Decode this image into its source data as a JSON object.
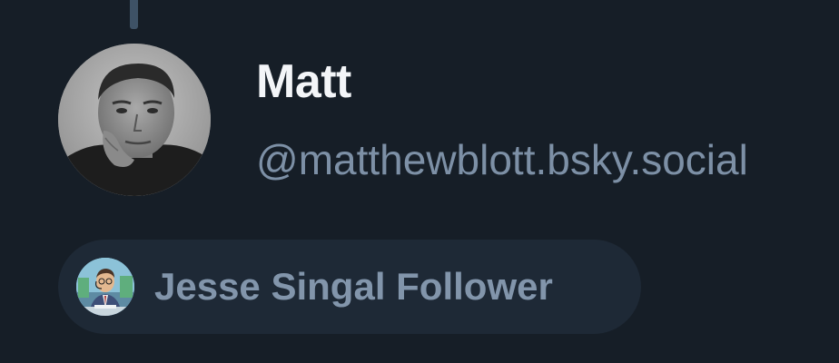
{
  "post": {
    "author": {
      "display_name": "Matt",
      "handle": "@matthewblott.bsky.social",
      "avatar_icon": "profile-photo"
    },
    "labels": [
      {
        "text": "Jesse Singal Follower",
        "icon": "labeler-avatar"
      }
    ]
  },
  "colors": {
    "background": "#161e27",
    "display_name": "#f3f5f8",
    "handle": "#7d90a6",
    "label_pill_bg": "#1e2936",
    "label_text": "#8295ab",
    "thread_line": "#3e5266"
  }
}
